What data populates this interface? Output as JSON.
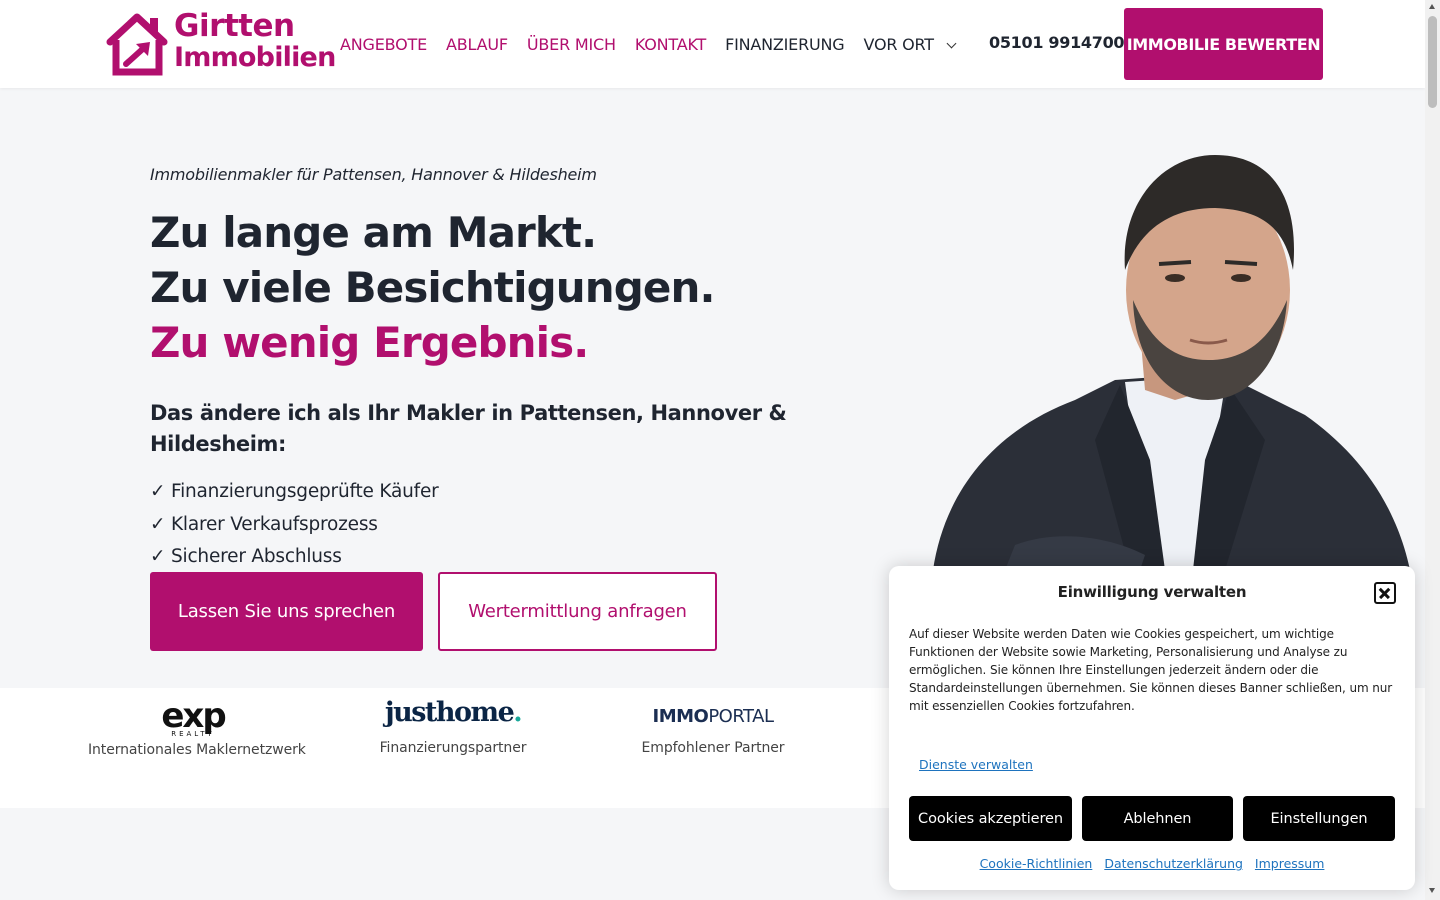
{
  "header": {
    "logo_line1": "Girtten",
    "logo_line2": "Immobilien",
    "nav": [
      {
        "label": "ANGEBOTE"
      },
      {
        "label": "ABLAUF"
      },
      {
        "label": "ÜBER MICH"
      },
      {
        "label": "KONTAKT"
      },
      {
        "label": "FINANZIERUNG"
      },
      {
        "label": "VOR ORT"
      }
    ],
    "phone": "05101 9914700",
    "cta": "IMMOBILIE BEWERTEN"
  },
  "hero": {
    "tagline": "Immobilienmakler für Pattensen, Hannover & Hildesheim",
    "headline": [
      "Zu lange am Markt.",
      "Zu viele Besichtigungen.",
      "Zu wenig Ergebnis."
    ],
    "subheadline": "Das ändere ich als Ihr Makler in Pattensen, Hannover & Hildesheim:",
    "checks": [
      "✓ Finanzierungsgeprüfte Käufer",
      "✓ Klarer Verkaufsprozess",
      "✓ Sicherer Abschluss"
    ],
    "btn_primary": "Lassen Sie uns sprechen",
    "btn_secondary": "Wertermittlung anfragen"
  },
  "partners": [
    {
      "logo": "exp",
      "logo_sub": "REALTY",
      "label": "Internationales Maklernetzwerk"
    },
    {
      "logo": "justhome",
      "logo_dot": ".",
      "label": "Finanzierungspartner"
    },
    {
      "logo_a": "IMMO",
      "logo_b": "PORTAL",
      "label": "Empfohlener Partner"
    }
  ],
  "cookie": {
    "title": "Einwilligung verwalten",
    "text": "Auf dieser Website werden Daten wie Cookies gespeichert, um wichtige Funktionen der Website sowie Marketing, Personalisierung und Analyse zu ermöglichen. Sie können Ihre Einstellungen jederzeit ändern oder die Standardeinstellungen übernehmen. Sie können dieses Banner schließen, um nur mit essenziellen Cookies fortzufahren.",
    "manage": "Dienste verwalten",
    "accept": "Cookies akzeptieren",
    "deny": "Ablehnen",
    "settings": "Einstellungen",
    "links": [
      "Cookie-Richtlinien",
      "Datenschutzerklärung",
      "Impressum"
    ]
  },
  "colors": {
    "brand": "#b10f6e",
    "text": "#1f2530",
    "link": "#1e73be",
    "hero_bg": "#f5f6f8"
  }
}
